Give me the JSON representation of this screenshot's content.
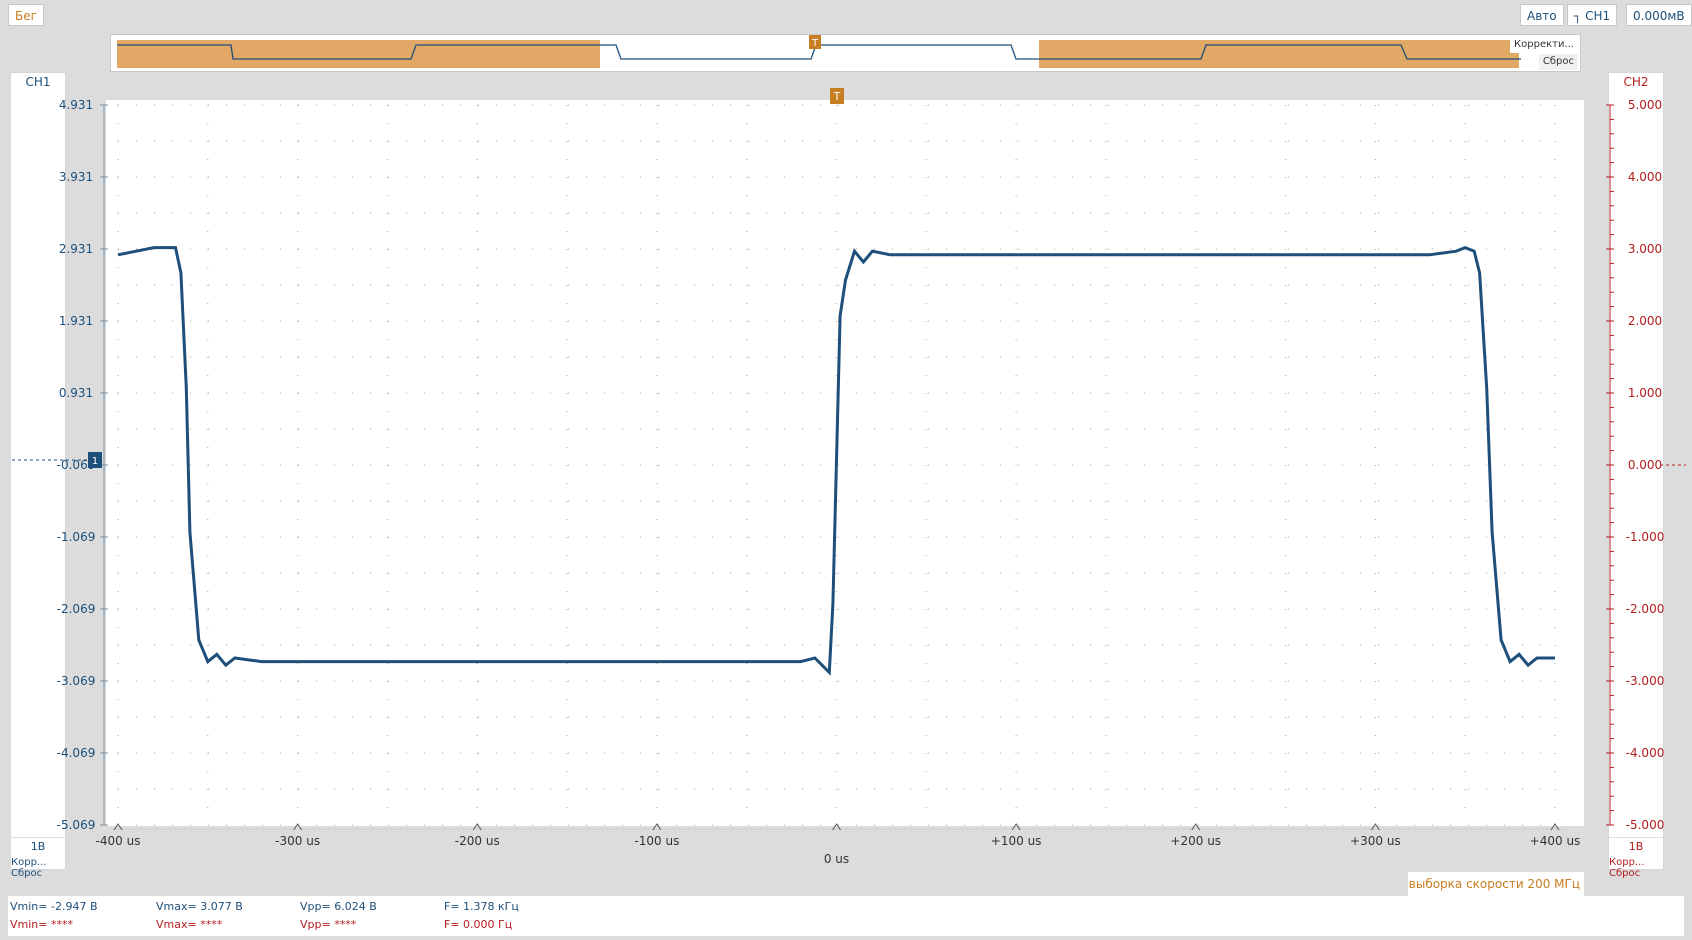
{
  "toolbar": {
    "run_label": "Бег",
    "trigger_mode": "Авто",
    "trigger_source": "CH1",
    "trigger_level": "0.000мВ",
    "trigger_edge_icon": "rising-edge-icon"
  },
  "overview": {
    "adjust_label": "Корректи...",
    "reset_label": "Сброс",
    "trigger_marker": "T"
  },
  "channels": {
    "ch1": {
      "title": "CH1",
      "scale": "1В",
      "footer": "Корр... Сброс",
      "color": "#1d4f7a",
      "ticks": [
        "4.931",
        "3.931",
        "2.931",
        "1.931",
        "0.931",
        "-0.069",
        "-1.069",
        "-2.069",
        "-3.069",
        "-4.069",
        "-5.069"
      ]
    },
    "ch2": {
      "title": "CH2",
      "scale": "1В",
      "footer": "Корр... Сброс",
      "color": "#b31d1d",
      "ticks": [
        "5.000",
        "4.000",
        "3.000",
        "2.000",
        "1.000",
        "0.000",
        "-1.000",
        "-2.000",
        "-3.000",
        "-4.000",
        "-5.000"
      ]
    }
  },
  "chart_data": {
    "type": "line",
    "x_tick_labels": [
      "-400 us",
      "-300 us",
      "-200 us",
      "-100 us",
      "0 us",
      "+100 us",
      "+200 us",
      "+300 us",
      "+400 us"
    ],
    "xlim": [
      -400,
      400
    ],
    "ylim": [
      -5.069,
      4.931
    ],
    "grid": true,
    "trigger_marker": "T",
    "series": [
      {
        "channel": "CH1",
        "x": [
          -400,
          -380,
          -368,
          -365,
          -362,
          -360,
          -355,
          -350,
          -345,
          -340,
          -335,
          -320,
          -300,
          -200,
          -100,
          -20,
          -12,
          -8,
          -4,
          -2,
          0,
          2,
          5,
          10,
          15,
          20,
          30,
          50,
          100,
          200,
          300,
          330,
          345,
          350,
          355,
          358,
          362,
          365,
          370,
          375,
          380,
          385,
          390,
          400
        ],
        "y": [
          2.85,
          2.95,
          2.95,
          2.6,
          1.0,
          -1.0,
          -2.5,
          -2.8,
          -2.7,
          -2.85,
          -2.75,
          -2.8,
          -2.8,
          -2.8,
          -2.8,
          -2.8,
          -2.75,
          -2.85,
          -2.95,
          -2.0,
          0.0,
          2.0,
          2.5,
          2.9,
          2.75,
          2.9,
          2.85,
          2.85,
          2.85,
          2.85,
          2.85,
          2.85,
          2.9,
          2.95,
          2.9,
          2.6,
          1.0,
          -1.0,
          -2.5,
          -2.8,
          -2.7,
          -2.85,
          -2.75,
          -2.75
        ]
      }
    ]
  },
  "sample_rate": "выборка скорости 200 МГц",
  "measurements": {
    "ch1": {
      "vmin": "Vmin= -2.947 В",
      "vmax": "Vmax= 3.077 В",
      "vpp": "Vpp= 6.024 В",
      "f": "F= 1.378 кГц"
    },
    "ch2": {
      "vmin": "Vmin= ****",
      "vmax": "Vmax= ****",
      "vpp": "Vpp= ****",
      "f": "F= 0.000 Гц"
    }
  },
  "colors": {
    "trace": "#1d4f7a",
    "accent": "#c77d21",
    "ch2": "#b31d1d"
  }
}
